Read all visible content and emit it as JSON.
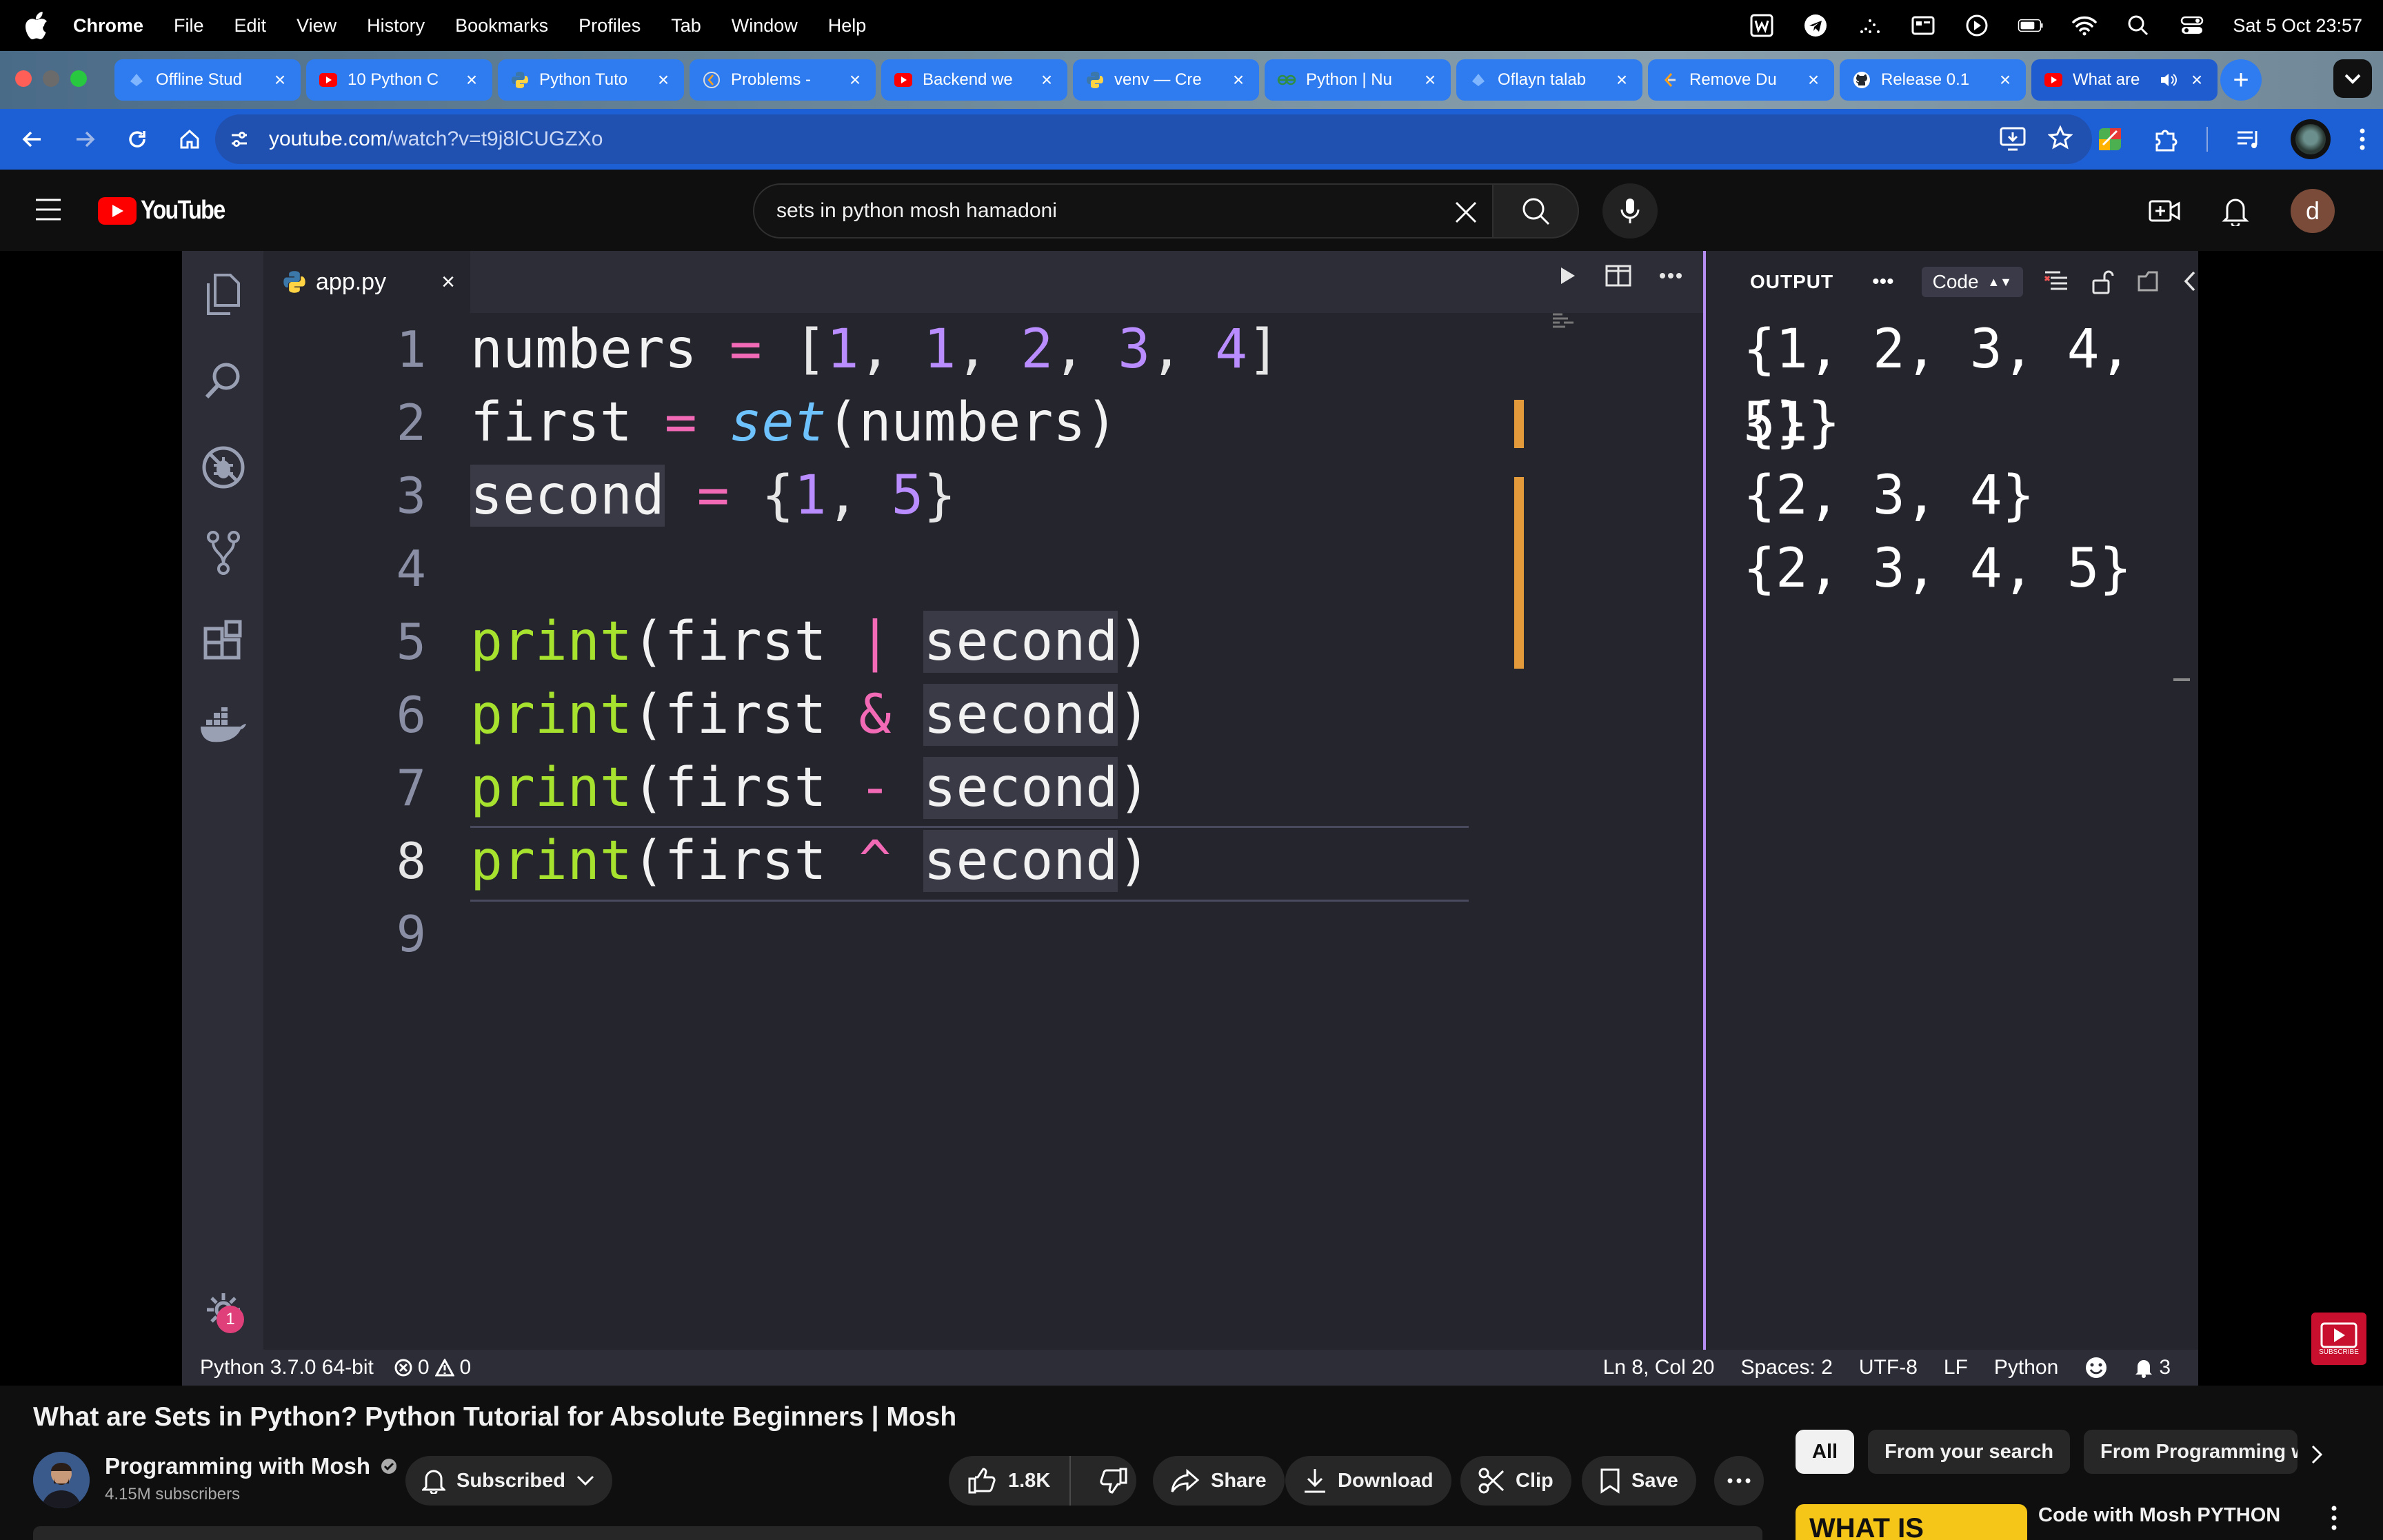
{
  "macbar": {
    "menu": [
      "Chrome",
      "File",
      "Edit",
      "View",
      "History",
      "Bookmarks",
      "Profiles",
      "Tab",
      "Window",
      "Help"
    ],
    "clock": "Sat 5 Oct  23:57"
  },
  "tabs": [
    {
      "title": "Offline Stud",
      "icon": "globe-icon"
    },
    {
      "title": "10 Python C",
      "icon": "youtube-icon"
    },
    {
      "title": "Python Tuto",
      "icon": "python-icon"
    },
    {
      "title": "Problems -",
      "icon": "leetcode-icon"
    },
    {
      "title": "Backend we",
      "icon": "youtube-icon"
    },
    {
      "title": "venv — Cre",
      "icon": "python-icon"
    },
    {
      "title": "Python | Nu",
      "icon": "gfg-icon"
    },
    {
      "title": "Oflayn talab",
      "icon": "globe-icon"
    },
    {
      "title": "Remove Du",
      "icon": "leetcode-icon"
    },
    {
      "title": "Release 0.1",
      "icon": "github-icon"
    },
    {
      "title": "What are",
      "icon": "youtube-icon"
    }
  ],
  "address": {
    "host": "youtube.com",
    "path": "/watch?v=t9j8lCUGZXo"
  },
  "youtube": {
    "logo": "YouTube",
    "search_value": "sets in python mosh hamadoni",
    "avatar_letter": "d"
  },
  "vscode": {
    "file_tab": "app.py",
    "lines": [
      "1",
      "2",
      "3",
      "4",
      "5",
      "6",
      "7",
      "8",
      "9"
    ],
    "code": {
      "l1": {
        "a": "numbers",
        "op": "=",
        "b": "[",
        "n1": "1",
        "c1": ", ",
        "n2": "1",
        "c2": ", ",
        "n3": "2",
        "c3": ", ",
        "n4": "3",
        "c4": ", ",
        "n5": "4",
        "e": "]"
      },
      "l2": {
        "a": "first",
        "op": "=",
        "fn": "set",
        "b": "(numbers)"
      },
      "l3": {
        "a": "second",
        "op": "=",
        "b": "{",
        "n1": "1",
        "c1": ", ",
        "n2": "5",
        "e": "}"
      },
      "l5": {
        "fn": "print",
        "a": "(first",
        "op": "|",
        "b": "second",
        "e": ")"
      },
      "l6": {
        "fn": "print",
        "a": "(first",
        "op": "&",
        "b": "second",
        "e": ")"
      },
      "l7": {
        "fn": "print",
        "a": "(first",
        "op": "-",
        "b": "second",
        "e": ")"
      },
      "l8": {
        "fn": "print",
        "a": "(first",
        "op": "^",
        "b": "second",
        "e": ")"
      }
    },
    "output_label": "OUTPUT",
    "output_select": "Code",
    "output_lines": [
      "{1, 2, 3, 4, 5}",
      "{1}",
      "{2, 3, 4}",
      "{2, 3, 4, 5}"
    ],
    "settings_badge": "1",
    "status_left": {
      "interpreter": "Python 3.7.0 64-bit",
      "errors": "0",
      "warnings": "0"
    },
    "status_right": {
      "position": "Ln 8, Col 20",
      "spaces": "Spaces: 2",
      "encoding": "UTF-8",
      "eol": "LF",
      "language": "Python",
      "notifications": "3"
    }
  },
  "video_info": {
    "title": "What are Sets in Python? Python Tutorial for Absolute Beginners | Mosh",
    "channel": "Programming with Mosh",
    "subscribers": "4.15M subscribers",
    "subscribed_label": "Subscribed",
    "likes": "1.8K",
    "share": "Share",
    "download": "Download",
    "clip": "Clip",
    "save": "Save",
    "watermark_label": "SUBSCRIBE"
  },
  "sidebar": {
    "chips": [
      "All",
      "From your search",
      "From Programming wit"
    ],
    "rec_thumb_text": "WHAT IS",
    "rec_title": "Code with Mosh PYTHON"
  }
}
